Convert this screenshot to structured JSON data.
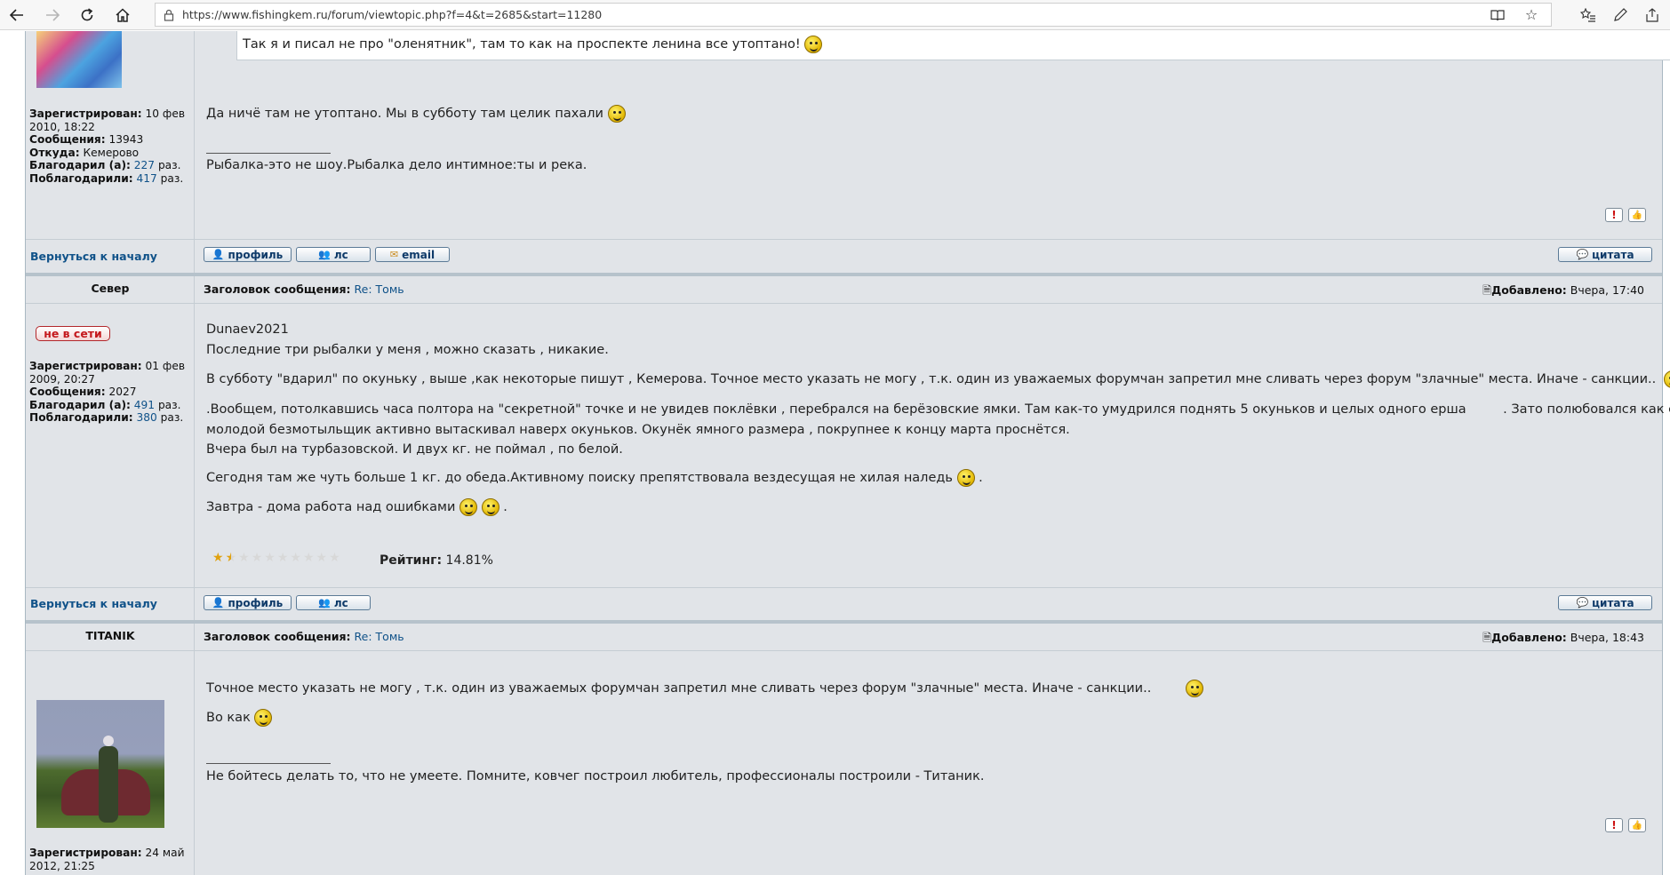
{
  "browser": {
    "url": "https://www.fishingkem.ru/forum/viewtopic.php?f=4&t=2685&start=11280"
  },
  "post1": {
    "quote_text": "Так я и писал не про \"оленятник\", там то как на проспекте ленина все утоптано!",
    "reply_text": "Да ничё там не утоптано. Мы в субботу там целик пахали",
    "signature": "Рыбалка-это не шоу.Рыбалка дело интимное:ты и река.",
    "profile": {
      "registered_label": "Зарегистрирован:",
      "registered_value": "10 фев",
      "registered_value2": "2010, 18:22",
      "posts_label": "Сообщения:",
      "posts_value": "13943",
      "from_label": "Откуда:",
      "from_value": "Кемерово",
      "thanked_label": "Благодарил (а):",
      "thanked_value": "227",
      "thanked_unit": "раз.",
      "thanks_label": "Поблагодарили:",
      "thanks_value": "417",
      "thanks_unit": "раз."
    }
  },
  "common": {
    "back_to_top": "Вернуться к началу",
    "btn_profile": "профиль",
    "btn_pm": "лс",
    "btn_email": "email",
    "btn_quote": "цитата",
    "subject_label": "Заголовок сообщения:",
    "subject_value": "Re: Томь",
    "posted_label": "Добавлено:",
    "report": "!",
    "thumb": "👍"
  },
  "post2": {
    "author": "Север",
    "status": "не в сети",
    "posted_value": "Вчера, 17:40",
    "lines": [
      "Dunaev2021",
      "Последние три рыбалки у меня , можно сказать , никакие.",
      "В субботу \"вдарил\" по окуньку , выше ,как некоторые пишут , Кемерова. Точное место указать не могу , т.к. один из уважаемых форумчан запретил мне сливать через форум \"злачные\" места. Иначе - санкции..",
      ".Вообщем, потолкавшись часа полтора на \"секретной\" точке и не увидев поклёвки , перебрался на берёзовские ямки. Там как-то умудрился поднять 5 окуньков и целых одного ерша",
      ". Зато полюбовался как славный",
      "молодой безмотыльщик активно вытаскивал наверх окуньков. Окунёк ямного размера , покрупнее к концу марта проснётся.",
      "Вчера был на турбазовской. И двух кг. не поймал , по белой.",
      "Сегодня там же чуть больше 1 кг. до обеда.Активному поиску препятствовала вездесущая не хилая наледь",
      ".",
      "Завтра - дома работа над ошибками",
      "."
    ],
    "rating_label": "Рейтинг:",
    "rating_value": "14.81%",
    "rating_stars_on": 1.5,
    "rating_stars_total": 10,
    "profile": {
      "registered_label": "Зарегистрирован:",
      "registered_value": "01 фев",
      "registered_value2": "2009, 20:27",
      "posts_label": "Сообщения:",
      "posts_value": "2027",
      "thanked_label": "Благодарил (а):",
      "thanked_value": "491",
      "thanked_unit": "раз.",
      "thanks_label": "Поблагодарили:",
      "thanks_value": "380",
      "thanks_unit": "раз."
    }
  },
  "post3": {
    "author": "TITANIK",
    "posted_value": "Вчера, 18:43",
    "line1": "Точное место указать не могу , т.к. один из уважаемых форумчан запретил мне сливать через форум \"злачные\" места. Иначе - санкции..",
    "line2": "Во как",
    "signature": "Не бойтесь делать то, что не умеете. Помните, ковчег построил любитель, профессионалы построили - Титаник.",
    "profile": {
      "registered_label": "Зарегистрирован:",
      "registered_value": "24 май",
      "registered_value2": "2012, 21:25"
    }
  }
}
